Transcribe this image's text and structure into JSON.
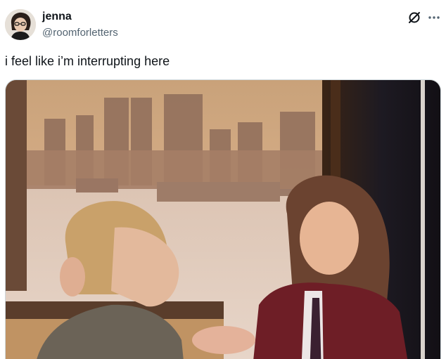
{
  "author": {
    "display_name": "jenna",
    "handle": "@roomforletters"
  },
  "tweet": {
    "text": "i feel like i’m interrupting here"
  },
  "icons": {
    "avatar": "profile-photo",
    "grok": "grok-icon",
    "more": "more-options-icon"
  },
  "colors": {
    "handle_gray": "#536471",
    "text_dark": "#0f1419",
    "border": "#cfd9de"
  }
}
